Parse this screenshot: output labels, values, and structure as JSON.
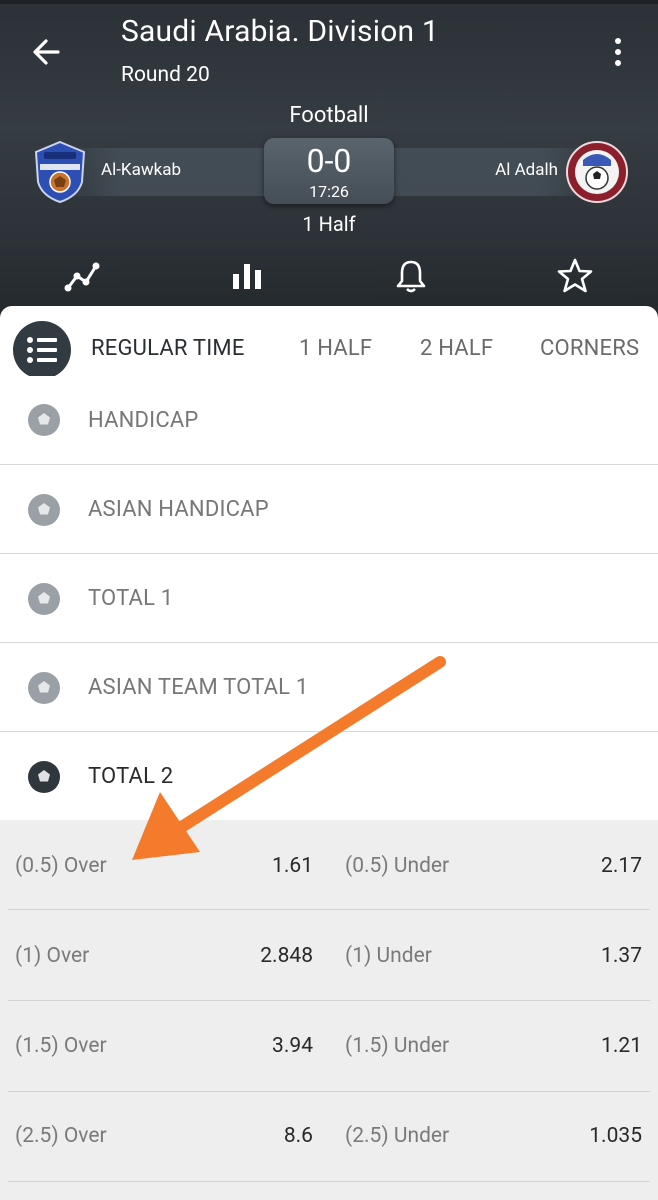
{
  "header": {
    "title": "Saudi Arabia. Division 1",
    "round": "Round 20",
    "sport": "Football",
    "home_team": "Al-Kawkab",
    "away_team": "Al Adalh",
    "score": "0-0",
    "clock": "17:26",
    "period": "1 Half"
  },
  "toolbar_icons": [
    "line-chart-icon",
    "bar-chart-icon",
    "bell-icon",
    "star-icon"
  ],
  "tabs": [
    {
      "label": "REGULAR TIME",
      "active": true
    },
    {
      "label": "1 HALF",
      "active": false
    },
    {
      "label": "2 HALF",
      "active": false
    },
    {
      "label": "CORNERS",
      "active": false
    }
  ],
  "markets": [
    {
      "label": "HANDICAP",
      "open": false
    },
    {
      "label": "ASIAN HANDICAP",
      "open": false
    },
    {
      "label": "TOTAL 1",
      "open": false
    },
    {
      "label": "ASIAN TEAM TOTAL 1",
      "open": false
    },
    {
      "label": "TOTAL 2",
      "open": true
    }
  ],
  "odds": [
    {
      "over_label": "(0.5) Over",
      "over_value": "1.61",
      "under_label": "(0.5) Under",
      "under_value": "2.17"
    },
    {
      "over_label": "(1) Over",
      "over_value": "2.848",
      "under_label": "(1) Under",
      "under_value": "1.37"
    },
    {
      "over_label": "(1.5) Over",
      "over_value": "3.94",
      "under_label": "(1.5) Under",
      "under_value": "1.21"
    },
    {
      "over_label": "(2.5) Over",
      "over_value": "8.6",
      "under_label": "(2.5) Under",
      "under_value": "1.035"
    }
  ],
  "colors": {
    "header_bg": "#2f363c",
    "active_tab": "#2a2f33",
    "annotation_arrow": "#f47a2c",
    "odds_bg": "#eeeeee"
  }
}
